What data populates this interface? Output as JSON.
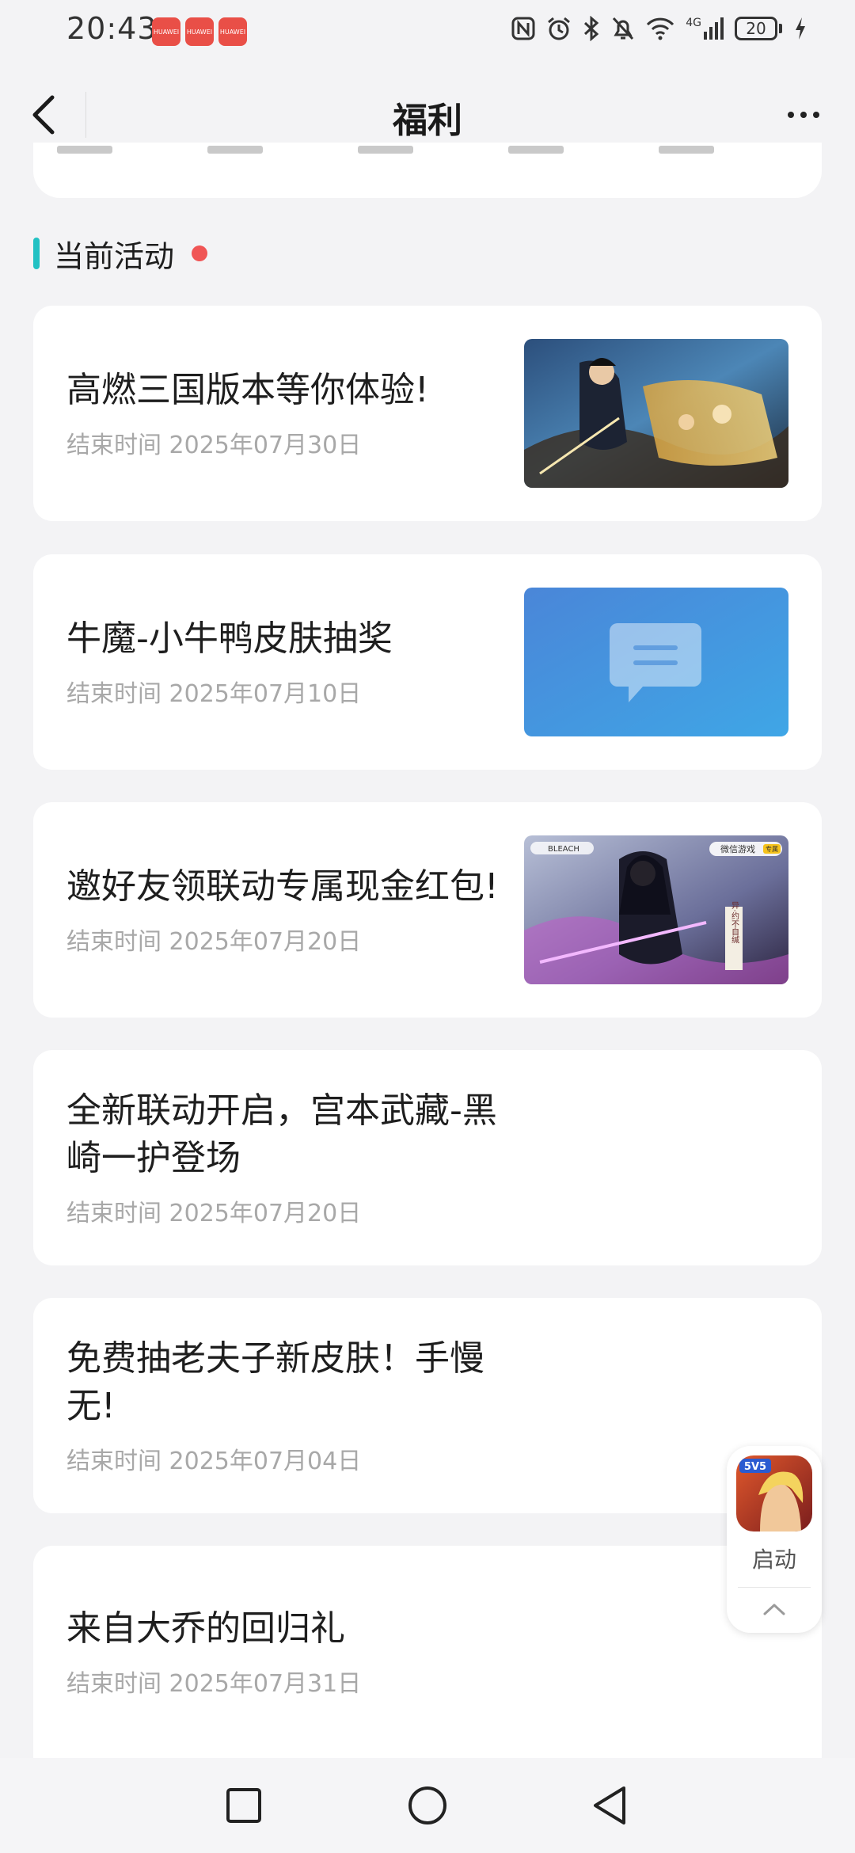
{
  "status_bar": {
    "time": "20:43",
    "notification_badges": [
      "HUAWEI",
      "HUAWEI",
      "HUAWEI"
    ],
    "network": "4G",
    "battery": "20"
  },
  "header": {
    "title": "福利"
  },
  "section": {
    "title": "当前活动"
  },
  "activities": [
    {
      "title": "高燃三国版本等你体验!",
      "end_time": "结束时间 2025年07月30日",
      "thumb": "game-art"
    },
    {
      "title": "牛魔-小牛鸭皮肤抽奖",
      "end_time": "结束时间 2025年07月10日",
      "thumb": "message-placeholder"
    },
    {
      "title": "邀好友领联动专属现金红包!",
      "end_time": "结束时间 2025年07月20日",
      "thumb": "bleach-collab-art",
      "thumb_text": {
        "collab": "BLEACH",
        "wechat_game": "微信游戏",
        "special": "专属",
        "tagline": "异·约不自缄"
      }
    },
    {
      "title": "全新联动开启，宫本武藏-黑崎一护登场",
      "end_time": "结束时间 2025年07月20日"
    },
    {
      "title": "免费抽老夫子新皮肤！手慢无!",
      "end_time": "结束时间 2025年07月04日"
    },
    {
      "title": "来自大乔的回归礼",
      "end_time": "结束时间 2025年07月31日"
    }
  ],
  "launch_widget": {
    "label": "启动",
    "app_badge": "5V5"
  },
  "colors": {
    "accent": "#22c1c3",
    "dot": "#f05555",
    "placeholder_blue": "#4a8fd9"
  }
}
